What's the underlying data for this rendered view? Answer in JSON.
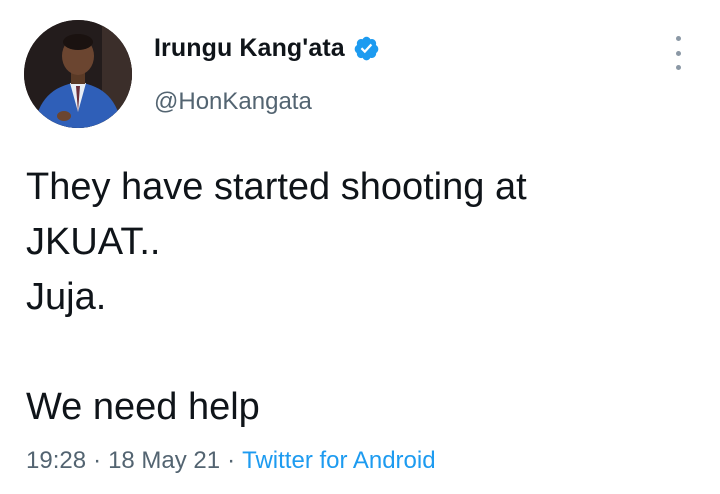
{
  "author": {
    "display_name": "Irungu Kang'ata",
    "handle": "@HonKangata",
    "verified": true,
    "verified_color": "#1d9bf0"
  },
  "tweet": {
    "lines": [
      "They have started shooting at",
      "JKUAT..",
      "Juja.",
      "",
      "We need help"
    ],
    "time": "19:28",
    "date": "18 May 21",
    "source": "Twitter for Android",
    "separator": "·"
  },
  "icons": {
    "more": "more-vertical-icon",
    "verified": "verified-badge-icon"
  },
  "colors": {
    "text": "#0f1419",
    "secondary": "#536471",
    "link": "#1d9bf0"
  }
}
